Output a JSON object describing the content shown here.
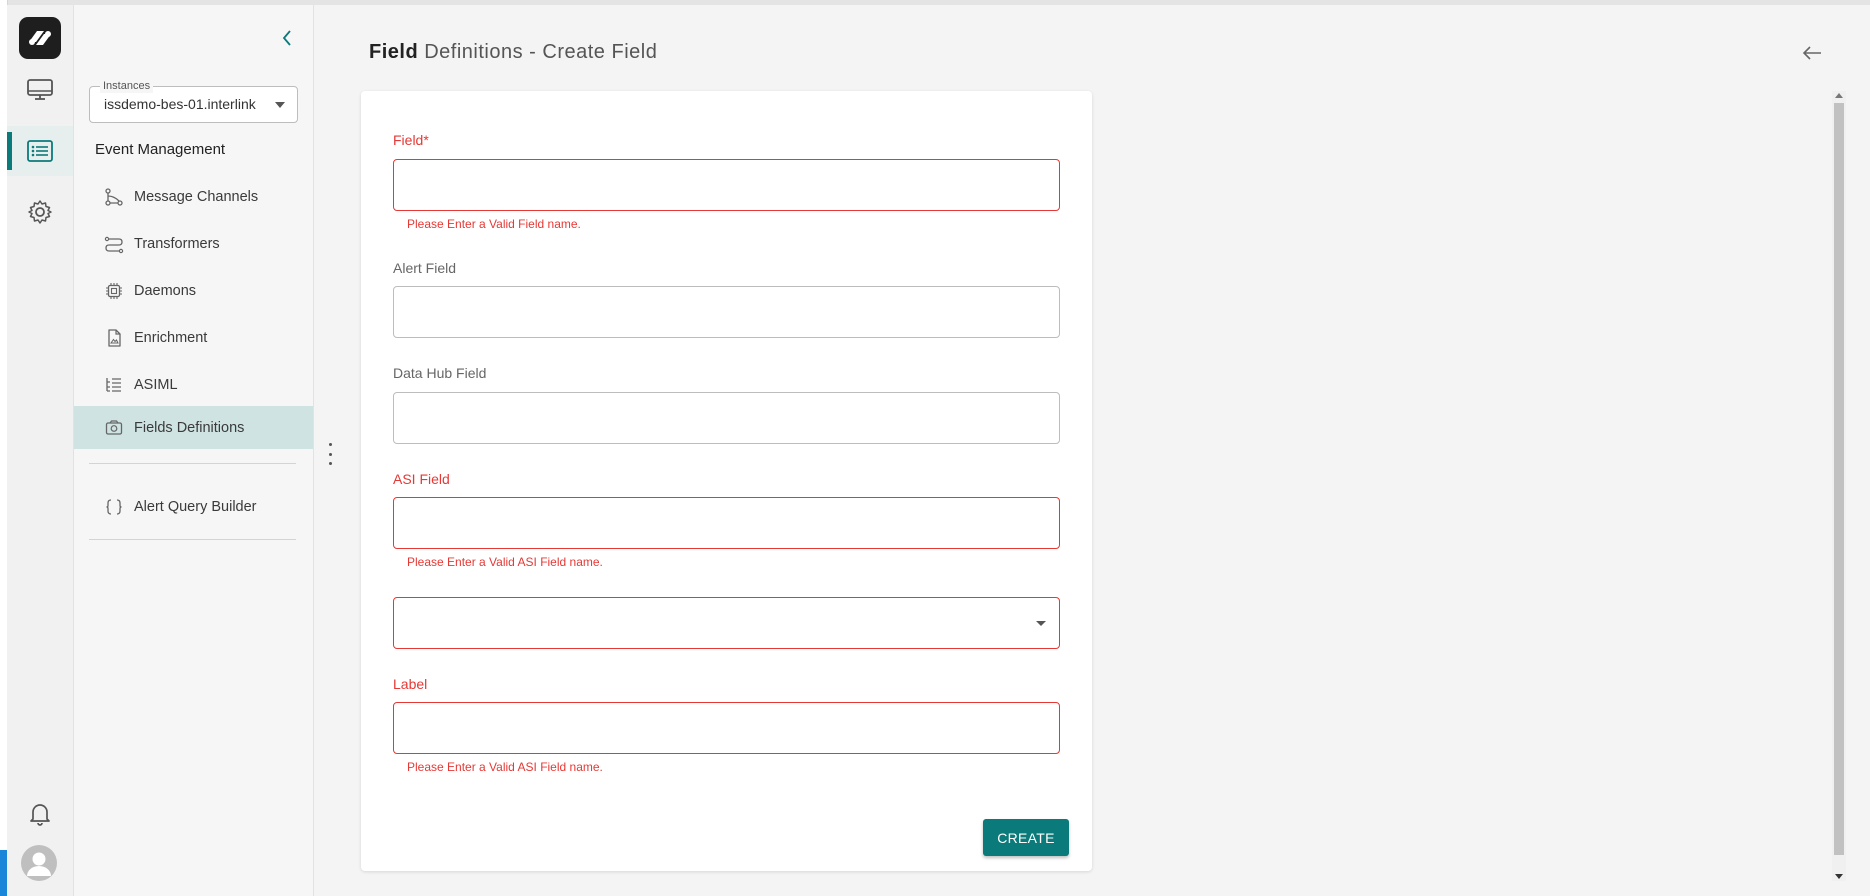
{
  "page": {
    "title_bold": "Field",
    "title_rest": "Definitions - Create Field"
  },
  "sidebar": {
    "instances_label": "Instances",
    "instances_value": "issdemo-bes-01.interlink",
    "section_title": "Event Management",
    "items": [
      {
        "label": "Message Channels",
        "icon": "message-channels-icon"
      },
      {
        "label": "Transformers",
        "icon": "transformers-icon"
      },
      {
        "label": "Daemons",
        "icon": "chip-icon"
      },
      {
        "label": "Enrichment",
        "icon": "document-icon"
      },
      {
        "label": "ASIML",
        "icon": "list-tree-icon"
      },
      {
        "label": "Fields Definitions",
        "icon": "fields-icon",
        "active": true
      }
    ],
    "extra_items": [
      {
        "label": "Alert Query Builder",
        "icon": "braces-icon"
      }
    ]
  },
  "rail": {
    "items": [
      "monitor-icon",
      "list-icon",
      "gear-icon"
    ],
    "bottom": [
      "bell-icon",
      "avatar-icon"
    ]
  },
  "form": {
    "field_label": "Field*",
    "field_error": "Please Enter a Valid Field name.",
    "alert_field_label": "Alert Field",
    "data_hub_field_label": "Data Hub Field",
    "asi_field_label": "ASI Field",
    "asi_field_error": "Please Enter a Valid ASI Field name.",
    "label_label": "Label",
    "label_error": "Please Enter a Valid ASI Field name.",
    "create_button": "CREATE"
  },
  "colors": {
    "accent": "#0b7a7a",
    "error": "#e53935",
    "active_nav": "#cfe3e3"
  }
}
